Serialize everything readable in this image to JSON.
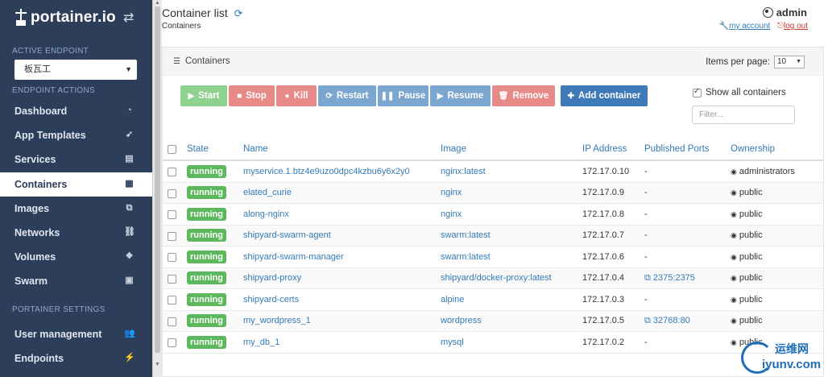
{
  "sidebar": {
    "brand": "portainer.io",
    "active_endpoint_label": "ACTIVE ENDPOINT",
    "endpoint_value": "板瓦工",
    "endpoint_actions_label": "ENDPOINT ACTIONS",
    "items": [
      {
        "label": "Dashboard",
        "icon": "tachometer-icon"
      },
      {
        "label": "App Templates",
        "icon": "rocket-icon"
      },
      {
        "label": "Services",
        "icon": "list-alt-icon"
      },
      {
        "label": "Containers",
        "icon": "server-icon"
      },
      {
        "label": "Images",
        "icon": "clone-icon"
      },
      {
        "label": "Networks",
        "icon": "sitemap-icon"
      },
      {
        "label": "Volumes",
        "icon": "cubes-icon"
      },
      {
        "label": "Swarm",
        "icon": "object-group-icon"
      }
    ],
    "settings_label": "PORTAINER SETTINGS",
    "settings_items": [
      {
        "label": "User management",
        "icon": "users-icon"
      },
      {
        "label": "Endpoints",
        "icon": "plug-icon"
      }
    ]
  },
  "header": {
    "title": "Container list",
    "breadcrumb": "Containers",
    "user": "admin",
    "my_account": "my account",
    "logout": "log out"
  },
  "panel": {
    "title": "Containers",
    "items_per_page_label": "Items per page:",
    "items_per_page_value": "10",
    "show_all_label": "Show all containers",
    "filter_placeholder": "Filter..."
  },
  "actions": {
    "start": "Start",
    "stop": "Stop",
    "kill": "Kill",
    "restart": "Restart",
    "pause": "Pause",
    "resume": "Resume",
    "remove": "Remove",
    "add": "Add container"
  },
  "table": {
    "headers": {
      "state": "State",
      "name": "Name",
      "image": "Image",
      "ip": "IP Address",
      "ports": "Published Ports",
      "ownership": "Ownership"
    },
    "rows": [
      {
        "state": "running",
        "name": "myservice.1.btz4e9uzo0dpc4kzbu6y6x2y0",
        "image": "nginx:latest",
        "ip": "172.17.0.10",
        "ports": "-",
        "ownership": "administrators"
      },
      {
        "state": "running",
        "name": "elated_curie",
        "image": "nginx",
        "ip": "172.17.0.9",
        "ports": "-",
        "ownership": "public"
      },
      {
        "state": "running",
        "name": "along-nginx",
        "image": "nginx",
        "ip": "172.17.0.8",
        "ports": "-",
        "ownership": "public"
      },
      {
        "state": "running",
        "name": "shipyard-swarm-agent",
        "image": "swarm:latest",
        "ip": "172.17.0.7",
        "ports": "-",
        "ownership": "public"
      },
      {
        "state": "running",
        "name": "shipyard-swarm-manager",
        "image": "swarm:latest",
        "ip": "172.17.0.6",
        "ports": "-",
        "ownership": "public"
      },
      {
        "state": "running",
        "name": "shipyard-proxy",
        "image": "shipyard/docker-proxy:latest",
        "ip": "172.17.0.4",
        "ports": "2375:2375",
        "ownership": "public"
      },
      {
        "state": "running",
        "name": "shipyard-certs",
        "image": "alpine",
        "ip": "172.17.0.3",
        "ports": "-",
        "ownership": "public"
      },
      {
        "state": "running",
        "name": "my_wordpress_1",
        "image": "wordpress",
        "ip": "172.17.0.5",
        "ports": "32768:80",
        "ownership": "public"
      },
      {
        "state": "running",
        "name": "my_db_1",
        "image": "mysql",
        "ip": "172.17.0.2",
        "ports": "-",
        "ownership": "public"
      }
    ]
  },
  "watermark": {
    "cn": "运维网",
    "en": "iyunv.com"
  },
  "colors": {
    "sidebar": "#2c3e5a",
    "accent": "#337ab7",
    "running": "#5cb85c"
  }
}
